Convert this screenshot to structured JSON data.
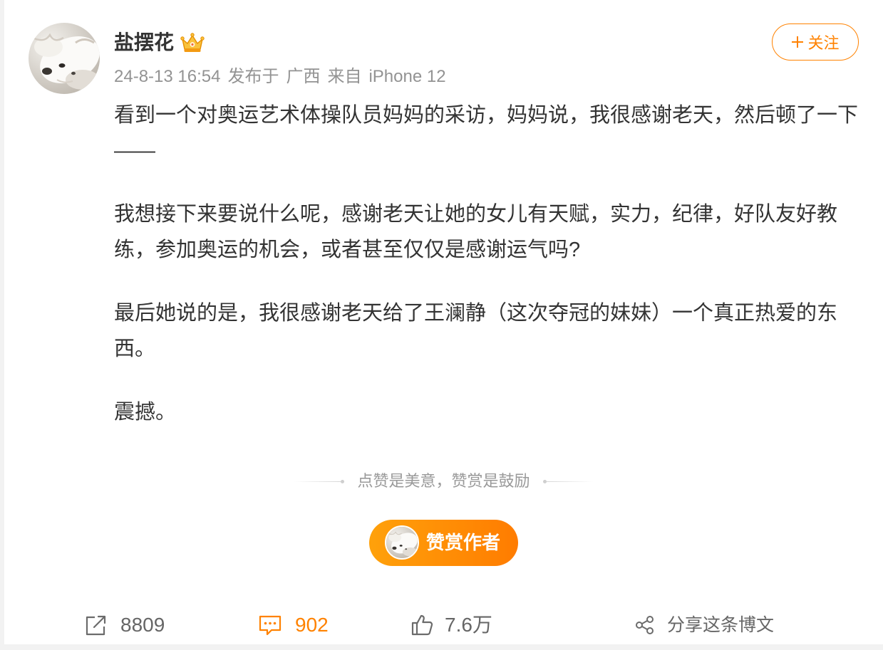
{
  "post": {
    "author": {
      "name": "盐摆花",
      "avatar_icon": "dog-avatar",
      "badge_icon": "crown-badge-icon"
    },
    "meta": {
      "time": "24-8-13 16:54",
      "location_prefix": "发布于",
      "location": "广西",
      "source_prefix": "来自",
      "source": "iPhone 12"
    },
    "follow_button": {
      "icon": "plus-icon",
      "label": "关注"
    },
    "content": {
      "paragraphs": [
        [
          "看到一个对奥运艺术体操队员妈妈的采访，妈妈说，我很感谢老天，然后顿了一下",
          "——"
        ],
        [
          "我想接下来要说什么呢，感谢老天让她的女儿有天赋，实力，纪律，好队友好教",
          "练，参加奥运的机会，或者甚至仅仅是感谢运气吗?"
        ],
        [
          "最后她说的是，我很感谢老天给了王澜静（这次夺冠的妹妹）一个真正热爱的东",
          "西。"
        ],
        [
          "震撼。"
        ]
      ]
    },
    "reward": {
      "divider_text": "点赞是美意，赞赏是鼓励",
      "button_label": "赞赏作者"
    },
    "actions": {
      "repost": {
        "icon": "repost-icon",
        "count": "8809"
      },
      "comment": {
        "icon": "comment-icon",
        "count": "902"
      },
      "like": {
        "icon": "thumbs-up-icon",
        "count": "7.6万"
      },
      "share": {
        "icon": "share-icon",
        "label": "分享这条博文"
      }
    }
  },
  "colors": {
    "accent": "#ff8200",
    "text": "#333333",
    "meta": "#939393",
    "muted": "#999999",
    "action_text": "#666666",
    "reward_start": "#ffa10b",
    "reward_end": "#ff7c00"
  }
}
